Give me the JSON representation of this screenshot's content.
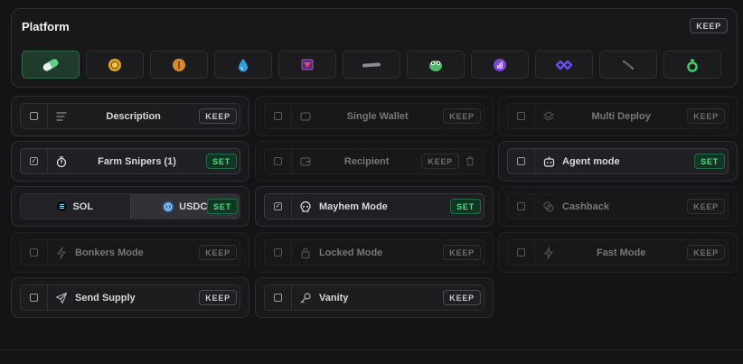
{
  "platform": {
    "title": "Platform",
    "keep_label": "KEEP",
    "options": [
      {
        "icon": "pill-icon",
        "selected": true
      },
      {
        "icon": "gold-coin-icon",
        "selected": false
      },
      {
        "icon": "bronze-coin-icon",
        "selected": false
      },
      {
        "icon": "droplet-icon",
        "selected": false
      },
      {
        "icon": "shield-logo-icon",
        "selected": false
      },
      {
        "icon": "bar-logo-icon",
        "selected": false
      },
      {
        "icon": "frog-icon",
        "selected": false
      },
      {
        "icon": "purple-chart-icon",
        "selected": false
      },
      {
        "icon": "infinity-icon",
        "selected": false
      },
      {
        "icon": "feather-icon",
        "selected": false
      },
      {
        "icon": "green-bag-icon",
        "selected": false
      }
    ]
  },
  "options": {
    "description": {
      "label": "Description",
      "badge": "KEEP"
    },
    "single_wallet": {
      "label": "Single Wallet",
      "badge": "KEEP"
    },
    "multi_deploy": {
      "label": "Multi Deploy",
      "badge": "KEEP"
    },
    "farm_snipers": {
      "label": "Farm Snipers (1)",
      "badge": "SET",
      "checked": true
    },
    "recipient": {
      "label": "Recipient",
      "badge": "KEEP"
    },
    "agent_mode": {
      "label": "Agent mode",
      "badge": "SET"
    },
    "currency": {
      "sol_label": "SOL",
      "usdc_label": "USDC",
      "badge": "SET",
      "selected": "USDC"
    },
    "mayhem_mode": {
      "label": "Mayhem Mode",
      "badge": "SET",
      "checked": true
    },
    "cashback": {
      "label": "Cashback",
      "badge": "KEEP"
    },
    "bonkers_mode": {
      "label": "Bonkers Mode",
      "badge": "KEEP"
    },
    "locked_mode": {
      "label": "Locked Mode",
      "badge": "KEEP"
    },
    "fast_mode": {
      "label": "Fast Mode",
      "badge": "KEEP"
    },
    "send_supply": {
      "label": "Send Supply",
      "badge": "KEEP"
    },
    "vanity": {
      "label": "Vanity",
      "badge": "KEEP"
    }
  },
  "colors": {
    "accent_green": "#4ee08a",
    "set_bg": "#123524",
    "selected_platform_bg": "#1f3b2c"
  }
}
